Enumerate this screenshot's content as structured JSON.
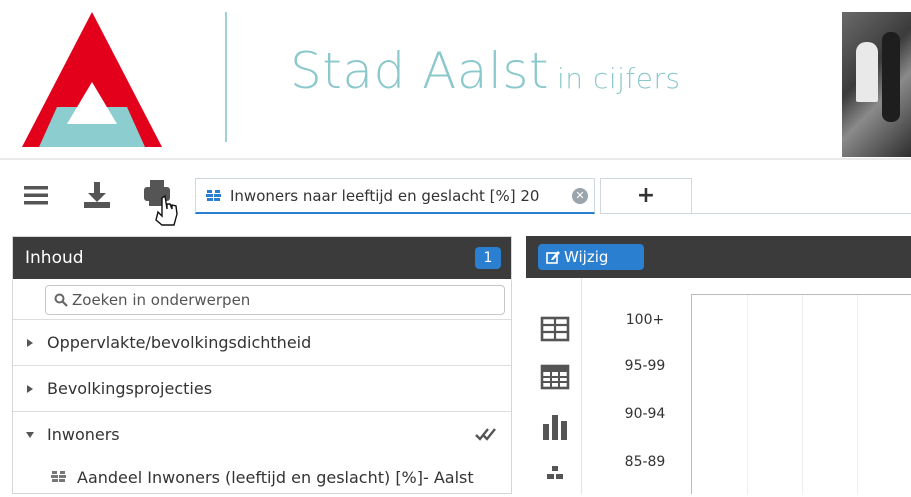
{
  "header": {
    "title": "Stad Aalst",
    "subtitle": "in cijfers",
    "colors": {
      "logo_red": "#e3001b",
      "logo_teal": "#8ccdd0",
      "title": "#8bc8cc"
    }
  },
  "toolbar": {
    "menu_icon": "hamburger-menu-icon",
    "download_icon": "download-icon",
    "print_icon": "print-icon"
  },
  "tabs": [
    {
      "label": "Inwoners naar leeftijd en geslacht [%] 20",
      "active": true
    },
    {
      "label": "+",
      "active": false
    }
  ],
  "left_panel": {
    "title": "Inhoud",
    "badge": "1",
    "search_placeholder": "Zoeken in onderwerpen",
    "items": [
      {
        "label": "Oppervlakte/bevolkingsdichtheid",
        "expanded": false
      },
      {
        "label": "Bevolkingsprojecties",
        "expanded": false
      },
      {
        "label": "Inwoners",
        "expanded": true,
        "checked": true
      }
    ],
    "subitems": [
      {
        "label": "Aandeel Inwoners (leeftijd en geslacht) [%]- Aalst"
      }
    ]
  },
  "right_panel": {
    "edit_button": "Wijzig",
    "view_icons": [
      "table-icon",
      "grid-table-icon",
      "bar-chart-icon",
      "population-pyramid-icon"
    ]
  },
  "chart_data": {
    "type": "bar",
    "categories": [
      "100+",
      "95-99",
      "90-94",
      "85-89"
    ],
    "title": "",
    "xlabel": "",
    "ylabel": ""
  }
}
